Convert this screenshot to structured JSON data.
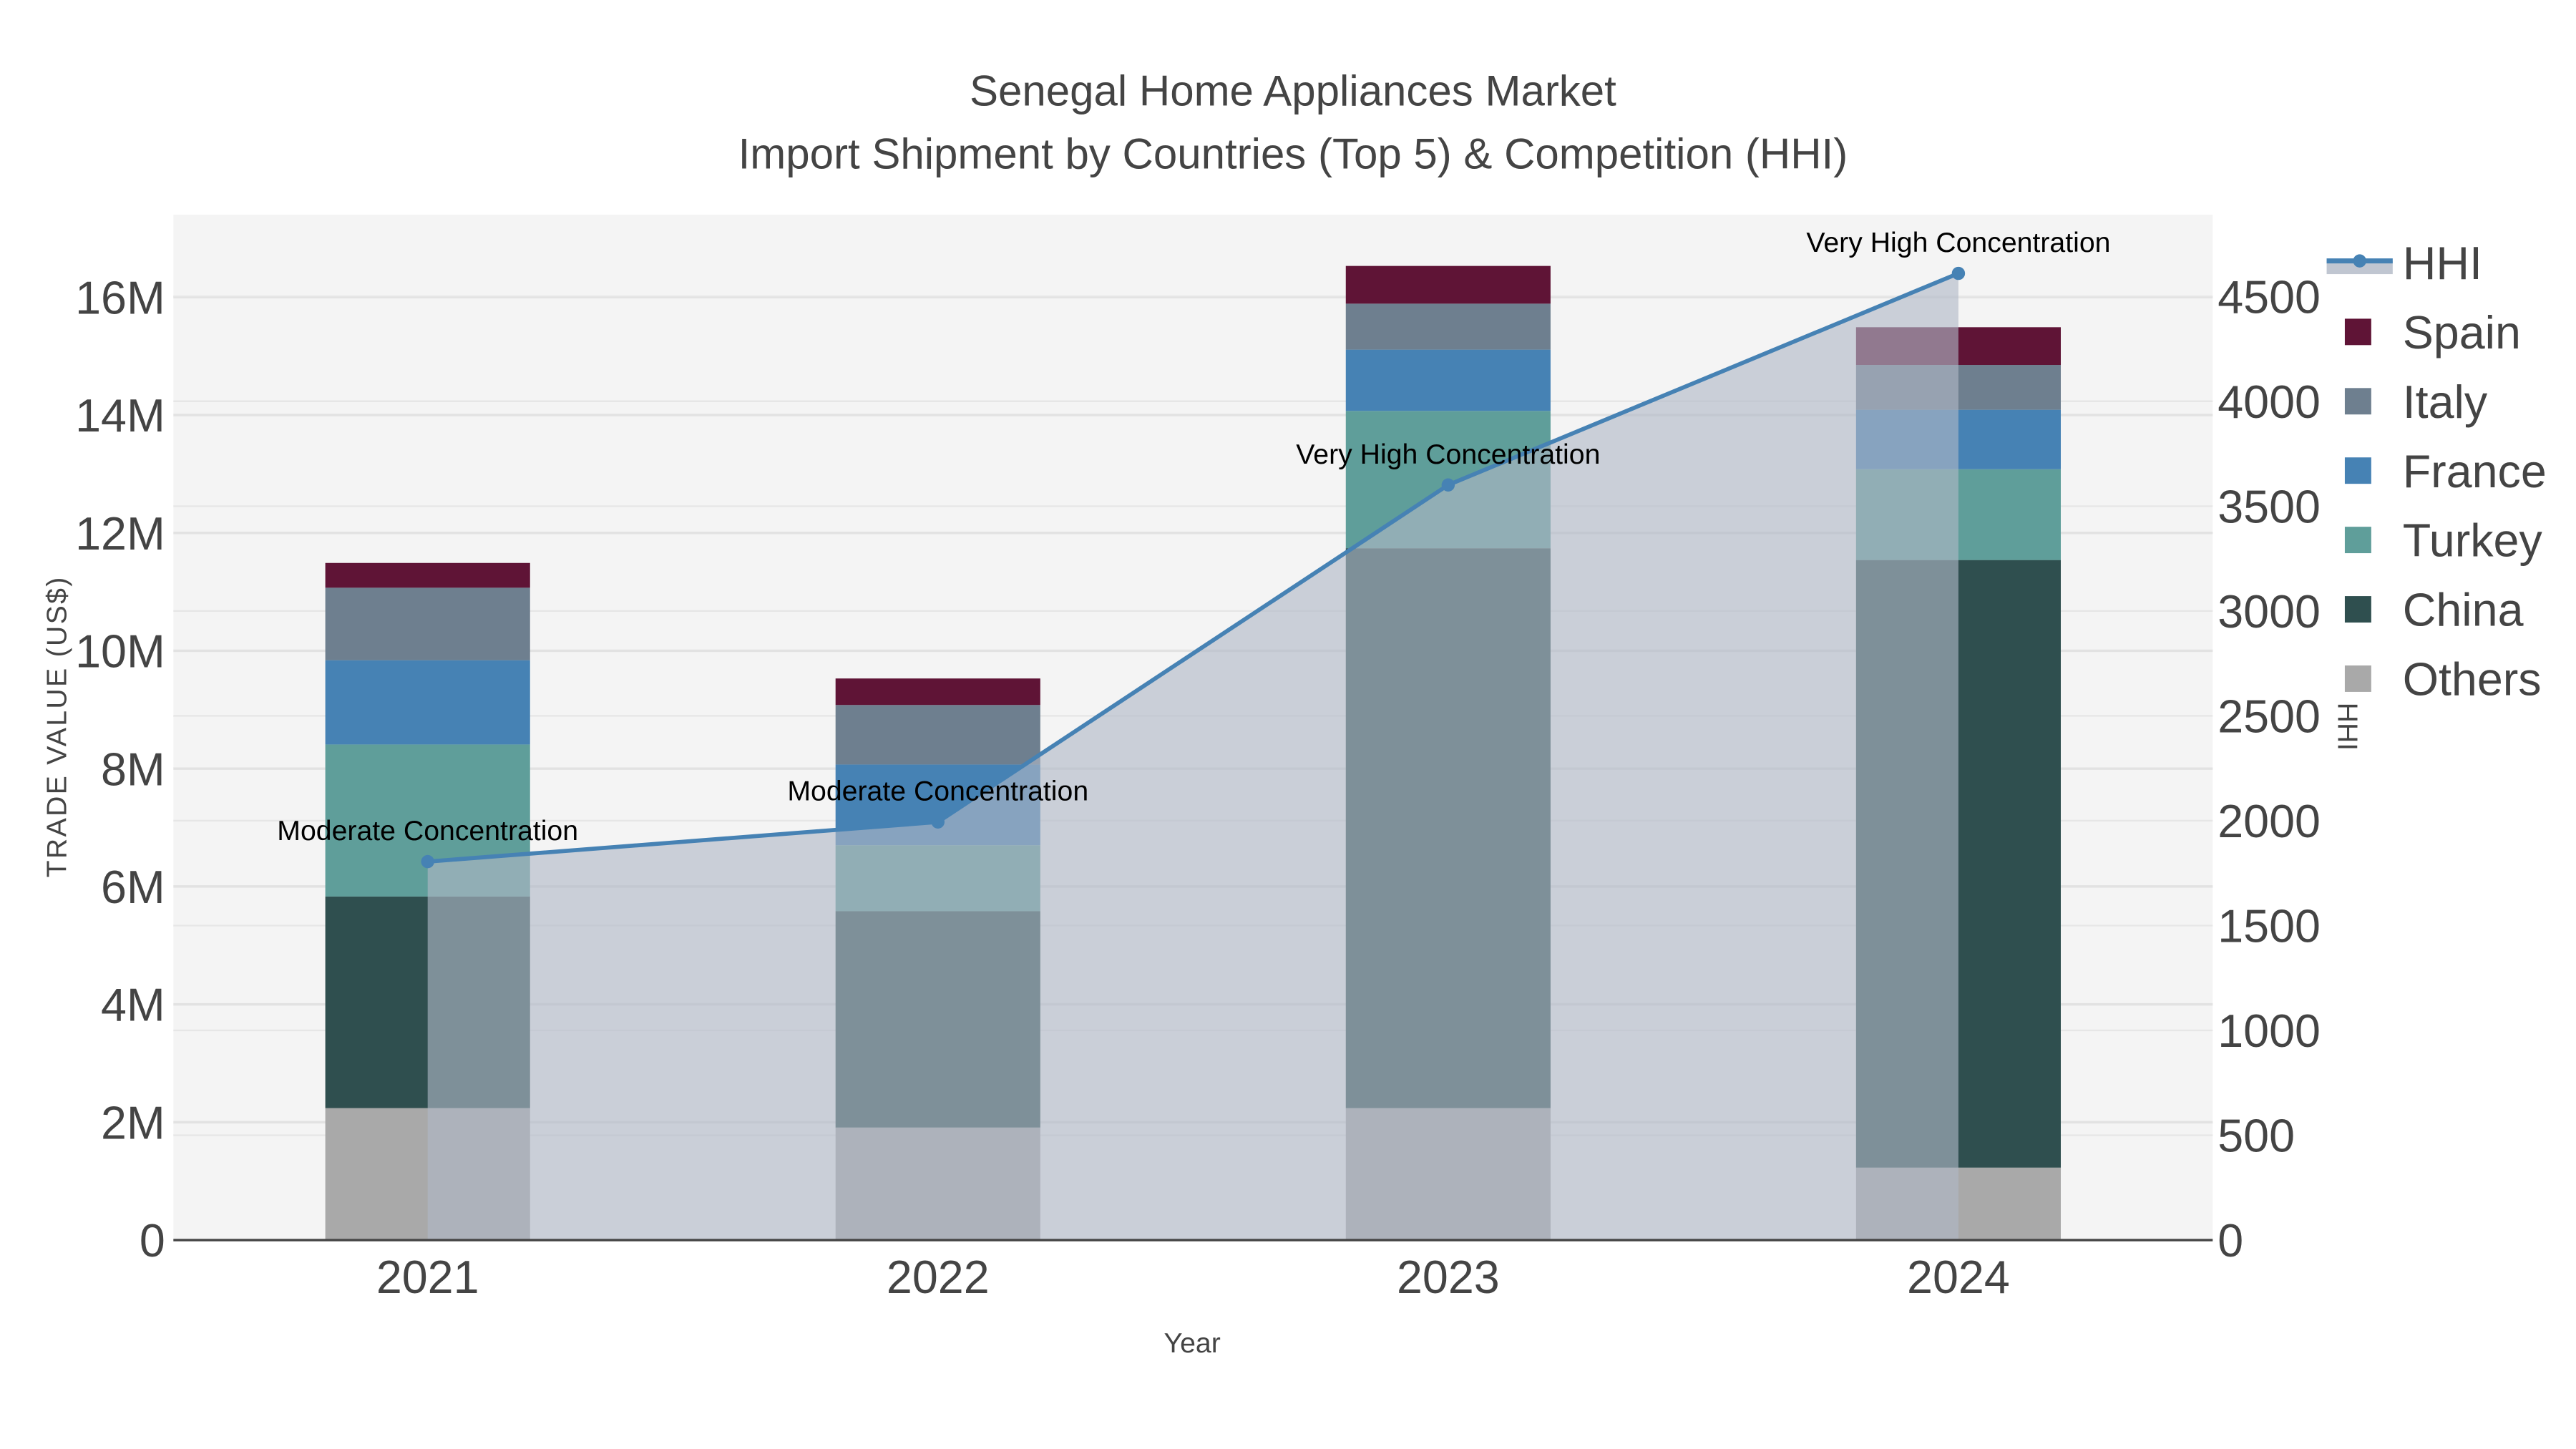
{
  "chart_data": {
    "type": "bar",
    "title_line1": "Senegal Home Appliances Market",
    "title_line2": "Import Shipment by Countries (Top 5) & Competition (HHI)",
    "xlabel": "Year",
    "ylabel": "TRADE VALUE (US$)",
    "y2label": "HHI",
    "categories": [
      "2021",
      "2022",
      "2023",
      "2024"
    ],
    "ylim": [
      0,
      17400000
    ],
    "y2lim": [
      0,
      4890
    ],
    "yticks": [
      0,
      2000000,
      4000000,
      6000000,
      8000000,
      10000000,
      12000000,
      14000000,
      16000000
    ],
    "ytick_labels": [
      "0",
      "2M",
      "4M",
      "6M",
      "8M",
      "10M",
      "12M",
      "14M",
      "16M"
    ],
    "y2ticks": [
      0,
      500,
      1000,
      1500,
      2000,
      2500,
      3000,
      3500,
      4000,
      4500
    ],
    "y2tick_labels": [
      "0",
      "500",
      "1000",
      "1500",
      "2000",
      "2500",
      "3000",
      "3500",
      "4000",
      "4500"
    ],
    "stacked": true,
    "series": [
      {
        "name": "Others",
        "color": "#a9a9a9",
        "values": [
          2240000,
          1910000,
          2240000,
          1230000
        ]
      },
      {
        "name": "China",
        "color": "#2f4f4f",
        "values": [
          3590000,
          3670000,
          9500000,
          10310000
        ]
      },
      {
        "name": "Turkey",
        "color": "#5f9e9a",
        "values": [
          2580000,
          1120000,
          2330000,
          1540000
        ]
      },
      {
        "name": "France",
        "color": "#4682b4",
        "values": [
          1430000,
          1370000,
          1040000,
          1010000
        ]
      },
      {
        "name": "Italy",
        "color": "#6e7f8f",
        "values": [
          1230000,
          1010000,
          780000,
          760000
        ]
      },
      {
        "name": "Spain",
        "color": "#5f1436",
        "values": [
          420000,
          450000,
          640000,
          640000
        ]
      }
    ],
    "line_series": {
      "name": "HHI",
      "color": "#4682b4",
      "axis": "right",
      "values": [
        1805,
        1994,
        3601,
        4610
      ],
      "annotations": [
        "Moderate Concentration",
        "Moderate Concentration",
        "Very High Concentration",
        "Very High Concentration"
      ]
    },
    "legend_order": [
      "HHI",
      "Spain",
      "Italy",
      "France",
      "Turkey",
      "China",
      "Others"
    ],
    "legend_position": "right",
    "grid": true
  }
}
